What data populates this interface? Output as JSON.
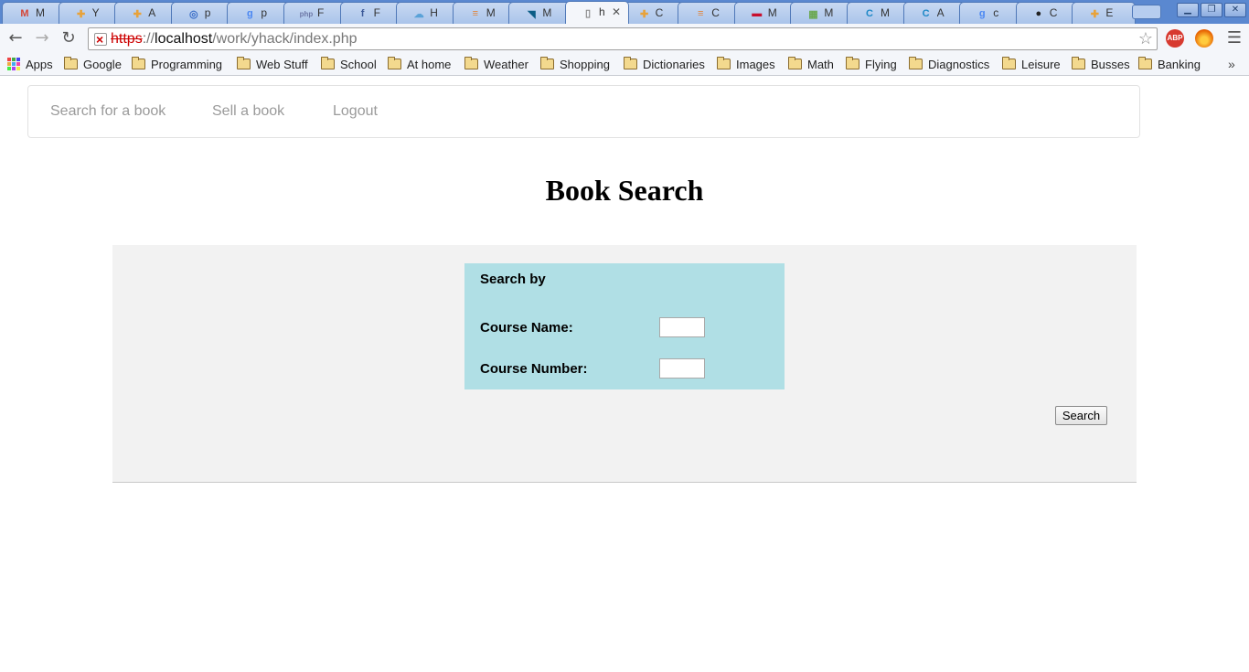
{
  "browser": {
    "tabs": [
      {
        "icon": "gmail-icon",
        "title": "M",
        "color": "#d44638"
      },
      {
        "icon": "puzzle-icon",
        "title": "Y",
        "color": "#e8a23a"
      },
      {
        "icon": "puzzle-icon",
        "title": "A",
        "color": "#e8a23a"
      },
      {
        "icon": "ring-icon",
        "title": "p",
        "color": "#3a6ec7"
      },
      {
        "icon": "google-icon",
        "title": "p",
        "color": "#4b87f2"
      },
      {
        "icon": "php-icon",
        "title": "F",
        "color": "#6d78a8"
      },
      {
        "icon": "facebook-icon",
        "title": "F",
        "color": "#3b5998"
      },
      {
        "icon": "cloud-icon",
        "title": "H",
        "color": "#5aa2d8"
      },
      {
        "icon": "stack-icon",
        "title": "M",
        "color": "#e0853d"
      },
      {
        "icon": "mysql-icon",
        "title": "M",
        "color": "#0b5d86"
      },
      {
        "icon": "page-icon",
        "title": "h",
        "color": "#888888",
        "active": true
      },
      {
        "icon": "puzzle-icon",
        "title": "C",
        "color": "#e8a23a"
      },
      {
        "icon": "stack-icon",
        "title": "C",
        "color": "#e0853d"
      },
      {
        "icon": "flag-icon",
        "title": "M",
        "color": "#c8102e"
      },
      {
        "icon": "map-icon",
        "title": "M",
        "color": "#6aa84f"
      },
      {
        "icon": "c-icon",
        "title": "M",
        "color": "#1e88c7"
      },
      {
        "icon": "c-icon",
        "title": "A",
        "color": "#1e88c7"
      },
      {
        "icon": "google-icon",
        "title": "c",
        "color": "#4b87f2"
      },
      {
        "icon": "github-icon",
        "title": "C",
        "color": "#222222"
      },
      {
        "icon": "puzzle-icon",
        "title": "E",
        "color": "#e8a23a"
      }
    ],
    "url": {
      "scheme": "https",
      "separator": "://",
      "host": "localhost",
      "path": "/work/yhack/index.php"
    },
    "extensions": [
      {
        "name": "adblock-plus-icon",
        "label": "ABP",
        "color": "#d73a30"
      },
      {
        "name": "firefox-icon",
        "label": "",
        "color": "#e66000"
      }
    ],
    "bookmarks": [
      {
        "label": "Apps",
        "type": "apps"
      },
      {
        "label": "Google",
        "type": "folder"
      },
      {
        "label": "Programming",
        "type": "folder"
      },
      {
        "label": "Web Stuff",
        "type": "folder"
      },
      {
        "label": "School",
        "type": "folder"
      },
      {
        "label": "At home",
        "type": "folder"
      },
      {
        "label": "Weather",
        "type": "folder"
      },
      {
        "label": "Shopping",
        "type": "folder"
      },
      {
        "label": "Dictionaries",
        "type": "folder"
      },
      {
        "label": "Images",
        "type": "folder"
      },
      {
        "label": "Math",
        "type": "folder"
      },
      {
        "label": "Flying",
        "type": "folder"
      },
      {
        "label": "Diagnostics",
        "type": "folder"
      },
      {
        "label": "Leisure",
        "type": "folder"
      },
      {
        "label": "Busses",
        "type": "folder"
      },
      {
        "label": "Banking",
        "type": "folder"
      }
    ],
    "bookmarks_more": "»"
  },
  "nav": {
    "links": [
      "Search for a book",
      "Sell a book",
      "Logout"
    ]
  },
  "page": {
    "title": "Book Search",
    "form": {
      "heading": "Search by",
      "course_name_label": "Course Name:",
      "course_number_label": "Course Number:",
      "course_name_value": "",
      "course_number_value": "",
      "submit_label": "Search"
    }
  },
  "colors": {
    "panel_bg": "#f2f2f2",
    "form_bg": "#b0dfe5",
    "nav_link": "#9a9a9a"
  }
}
